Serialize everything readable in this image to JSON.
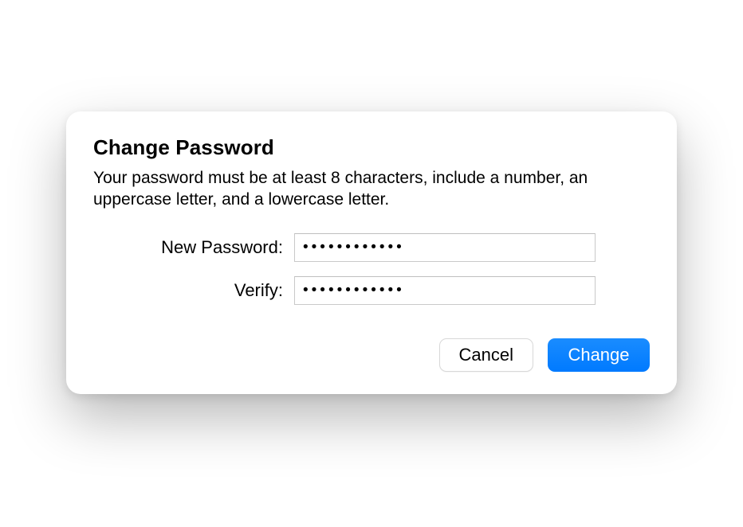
{
  "dialog": {
    "title": "Change Password",
    "description": "Your password must be at least 8 characters, include a number, an uppercase letter, and a lowercase letter.",
    "fields": {
      "new_password": {
        "label": "New Password:",
        "value": "●●●●●●●●●●●●"
      },
      "verify": {
        "label": "Verify:",
        "value": "●●●●●●●●●●●●"
      }
    },
    "buttons": {
      "cancel": "Cancel",
      "confirm": "Change"
    }
  }
}
